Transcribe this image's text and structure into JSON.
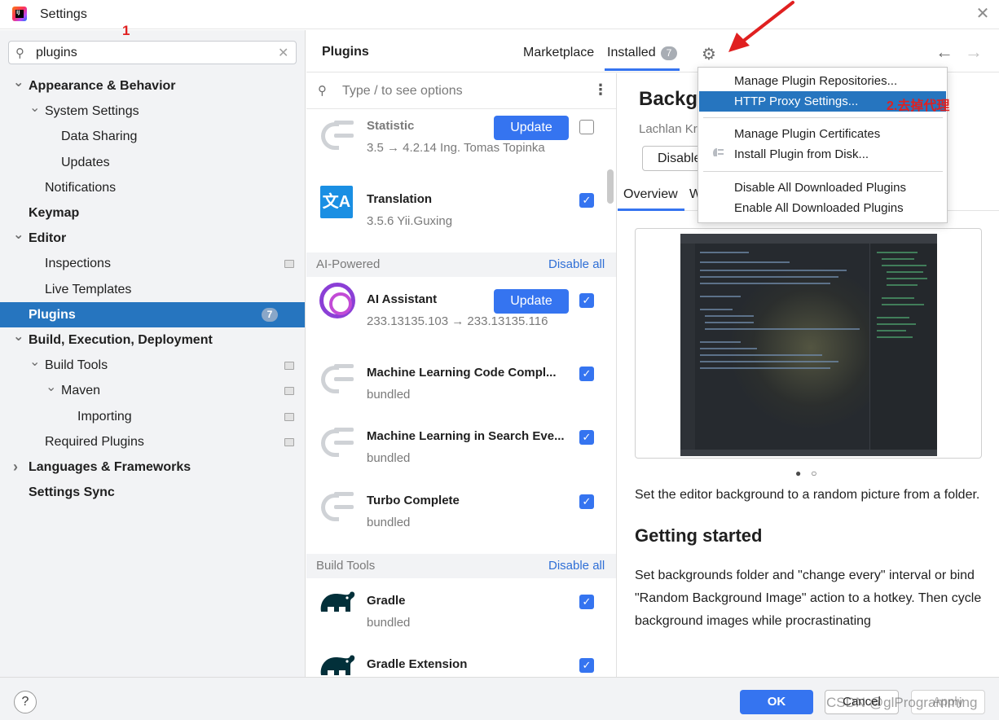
{
  "window": {
    "title": "Settings"
  },
  "annotations": {
    "step1": "1",
    "step2": "2.去掉代理"
  },
  "search": {
    "value": "plugins"
  },
  "tree": [
    {
      "label": "Appearance & Behavior",
      "bold": true,
      "level": 0,
      "arrow": "expanded"
    },
    {
      "label": "System Settings",
      "bold": false,
      "level": 1,
      "arrow": "expanded"
    },
    {
      "label": "Data Sharing",
      "bold": false,
      "level": 2,
      "arrow": "none"
    },
    {
      "label": "Updates",
      "bold": false,
      "level": 2,
      "arrow": "none"
    },
    {
      "label": "Notifications",
      "bold": false,
      "level": 1,
      "arrow": "none"
    },
    {
      "label": "Keymap",
      "bold": true,
      "level": 0,
      "arrow": "none"
    },
    {
      "label": "Editor",
      "bold": true,
      "level": 0,
      "arrow": "expanded"
    },
    {
      "label": "Inspections",
      "bold": false,
      "level": 1,
      "arrow": "none",
      "icon": true
    },
    {
      "label": "Live Templates",
      "bold": false,
      "level": 1,
      "arrow": "none"
    },
    {
      "label": "Plugins",
      "bold": true,
      "level": 0,
      "arrow": "none",
      "selected": true,
      "count": "7"
    },
    {
      "label": "Build, Execution, Deployment",
      "bold": true,
      "level": 0,
      "arrow": "expanded"
    },
    {
      "label": "Build Tools",
      "bold": false,
      "level": 1,
      "arrow": "expanded",
      "icon": true
    },
    {
      "label": "Maven",
      "bold": false,
      "level": 2,
      "arrow": "expanded",
      "icon": true
    },
    {
      "label": "Importing",
      "bold": false,
      "level": 3,
      "arrow": "none",
      "icon": true
    },
    {
      "label": "Required Plugins",
      "bold": false,
      "level": 1,
      "arrow": "none",
      "icon": true
    },
    {
      "label": "Languages & Frameworks",
      "bold": true,
      "level": 0,
      "arrow": "collapsed"
    },
    {
      "label": "Settings Sync",
      "bold": true,
      "level": 0,
      "arrow": "none"
    }
  ],
  "header": {
    "title": "Plugins",
    "tab_marketplace": "Marketplace",
    "tab_installed": "Installed",
    "installed_count": "7"
  },
  "list": {
    "search_placeholder": "Type / to see options",
    "plugins": [
      {
        "name": "Statistic",
        "meta": "3.5 → 4.2.14  Ing. Tomas Topinka",
        "update": "Update",
        "checked": false,
        "icon": "generic-plugin"
      },
      {
        "name": "Translation",
        "meta": "3.5.6  Yii.Guxing",
        "checked": true,
        "icon": "translation"
      },
      {
        "name": "AI Assistant",
        "meta": "233.13135.103 → 233.13135.116",
        "update": "Update",
        "checked": true,
        "icon": "ai-assistant"
      },
      {
        "name": "Machine Learning Code Compl...",
        "meta": "bundled",
        "checked": true,
        "icon": "generic-plugin"
      },
      {
        "name": "Machine Learning in Search Eve...",
        "meta": "bundled",
        "checked": true,
        "icon": "generic-plugin"
      },
      {
        "name": "Turbo Complete",
        "meta": "bundled",
        "checked": true,
        "icon": "generic-plugin"
      },
      {
        "name": "Gradle",
        "meta": "bundled",
        "checked": true,
        "icon": "gradle"
      },
      {
        "name": "Gradle Extension",
        "meta": "",
        "checked": true,
        "icon": "gradle"
      }
    ],
    "sections": [
      {
        "label": "AI-Powered",
        "link": "Disable all"
      },
      {
        "label": "Build Tools",
        "link": "Disable all"
      }
    ]
  },
  "detail": {
    "title": "Backgr",
    "author": "Lachlan Kr",
    "disable_button": "Disable",
    "tab_overview": "Overview",
    "tab_other": "W",
    "description": "Set the editor background to a random picture from a folder.",
    "heading": "Getting started",
    "paragraph": "Set backgrounds folder and \"change every\" interval or bind \"Random Background Image\" action to a hotkey. Then cycle background images while procrastinating"
  },
  "popup": {
    "items": [
      {
        "label": "Manage Plugin Repositories..."
      },
      {
        "label": "HTTP Proxy Settings...",
        "active": true
      },
      {
        "label": "Manage Plugin Certificates"
      },
      {
        "label": "Install Plugin from Disk..."
      },
      {
        "label": "Disable All Downloaded Plugins"
      },
      {
        "label": "Enable All Downloaded Plugins"
      }
    ]
  },
  "footer": {
    "help": "?",
    "ok": "OK",
    "cancel": "Cancel",
    "apply": "Apply",
    "watermark": "CSDN @glProgramming"
  },
  "colors": {
    "accent": "#3574f0",
    "selection": "#2675bf",
    "annotation_red": "#e02020"
  }
}
